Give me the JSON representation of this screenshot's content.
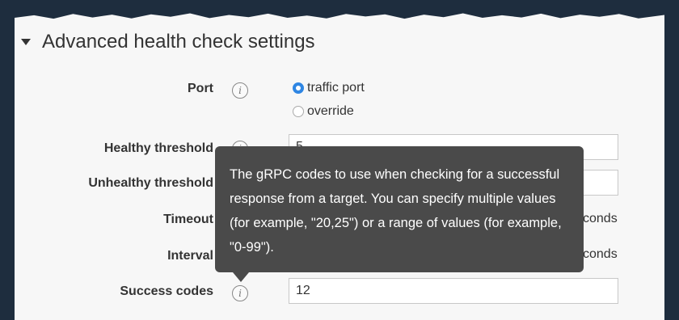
{
  "section": {
    "title": "Advanced health check settings"
  },
  "port": {
    "label": "Port",
    "option_traffic": "traffic port",
    "option_override": "override",
    "selected": "traffic port"
  },
  "healthy_threshold": {
    "label": "Healthy threshold",
    "value": "5"
  },
  "unhealthy_threshold": {
    "label": "Unhealthy threshold",
    "value": ""
  },
  "timeout": {
    "label": "Timeout",
    "suffix": "conds"
  },
  "interval": {
    "label": "Interval",
    "suffix": "conds"
  },
  "success_codes": {
    "label": "Success codes",
    "value": "12"
  },
  "tooltip": {
    "text": "The gRPC codes to use when checking for a successful response from a target. You can specify multiple values (for example, \"20,25\") or a range of values (for example, \"0-99\")."
  },
  "colors": {
    "background": "#1e2d3e",
    "radio_selected": "#2f86e3",
    "tooltip_bg": "#4a4a4a"
  }
}
